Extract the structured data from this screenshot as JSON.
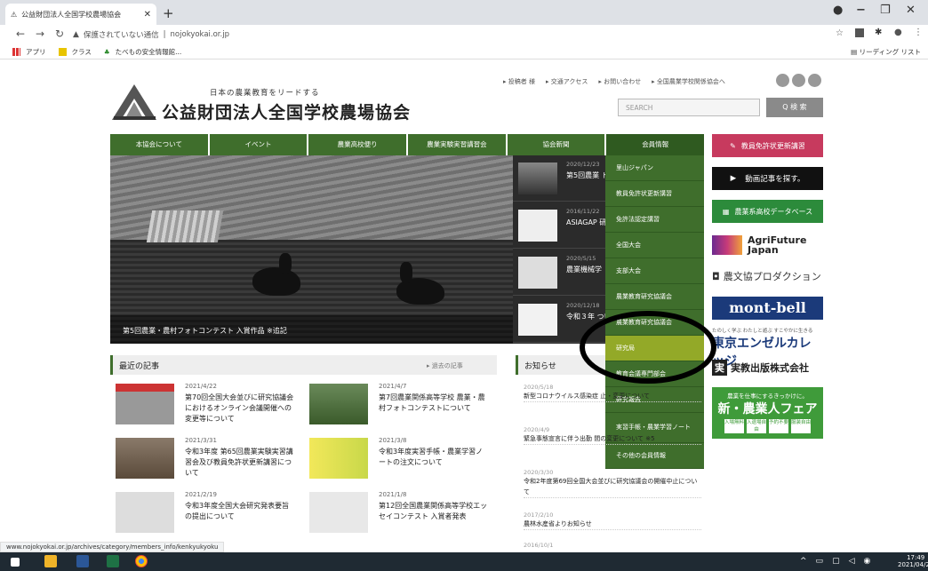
{
  "browser": {
    "tab_title": "公益財団法人全国学校農場協会",
    "address": "nojokyokai.or.jp",
    "security_label": "保護されていない通信",
    "bookmarks": [
      "アプリ",
      "クラス",
      "たべもの安全情報館..."
    ],
    "reading_list": "リーディング リスト"
  },
  "header": {
    "top_links": [
      "▸ 投稿者 様",
      "▸ 交通アクセス",
      "▸ お問い合わせ",
      "▸ 全国農業学校関係協会へ"
    ],
    "tagline": "日本の農業教育をリードする",
    "site_name": "公益財団法人全国学校農場協会",
    "search_placeholder": "SEARCH",
    "search_button": "Q 検 索"
  },
  "gnav": [
    "本協会について",
    "イベント",
    "農業高校便り",
    "農業実験実習講習会",
    "協会新聞",
    "会員情報"
  ],
  "hero": {
    "caption": "第5回農業・農村フォトコンテスト 入賞作品 ※追記",
    "thumbs": [
      {
        "date": "2020/12/23",
        "title": "第5回農業 ト 入賞作"
      },
      {
        "date": "2016/11/22",
        "title": "ASIAGAP 研修 て"
      },
      {
        "date": "2020/5/15",
        "title": "農業機械学 ト・QA"
      },
      {
        "date": "2020/12/18",
        "title": "令和３年 つい"
      }
    ]
  },
  "dropdown": [
    "里山ジャパン",
    "教員免許状更新講習",
    "免許法認定講習",
    "全国大会",
    "支部大会",
    "農業教育研究協議会",
    "農業教育研究協議会",
    "研究局",
    "教育会議専門部会",
    "研究報告",
    "実習手帳・農業学習ノート",
    "その他の会員情報"
  ],
  "sidebar": {
    "ad1": "教員免許状更新講習",
    "ad2": "動画記事を探す。",
    "ad3": "農業系高校データベース",
    "ad4": "AgriFuture Japan",
    "ad5": "農文協プロダクション",
    "ad6": "mont-bell",
    "ad7_sub": "たのしく学ぶ わたしと遊ぶ すこやかに生きる",
    "ad7": "東京エンゼルカレッジ",
    "ad8": "実教出版株式会社",
    "ad9_sub": "農業を仕事にするきっかけに。",
    "ad9": "新・農業人フェア",
    "ad9_btns": [
      "入場無料",
      "入退場自由",
      "予約不要",
      "服装自由"
    ]
  },
  "latest": {
    "title": "最近の記事",
    "more": "▸ 過去の記事",
    "items": [
      {
        "date": "2021/4/22",
        "title": "第70回全国大会並びに研究協議会におけるオンライン会議開催への変更等について"
      },
      {
        "date": "2021/4/7",
        "title": "第7回農業関係高等学校 農業・農村フォトコンテストについて"
      },
      {
        "date": "2021/3/31",
        "title": "令和3年度 第65回農業実験実習講習会及び教員免許状更新講習について"
      },
      {
        "date": "2021/3/8",
        "title": "令和3年度実習手帳・農業学習ノートの注文について"
      },
      {
        "date": "2021/2/19",
        "title": "令和3年度全国大会研究発表要旨の提出について"
      },
      {
        "date": "2021/1/8",
        "title": "第12回全国農業関係高等学校エッセイコンテスト 入賞者発表"
      }
    ]
  },
  "news": {
    "title": "お知らせ",
    "items": [
      {
        "date": "2020/5/18",
        "title": "新型コロナウイルス感染症 止・変更について"
      },
      {
        "date": "2020/4/9",
        "title": "緊急事態宣言に伴う出勤 間の変更について ※5"
      },
      {
        "date": "2020/3/30",
        "title": "令和2年度第69回全国大会並びに研究協議会の開催中止について"
      },
      {
        "date": "2017/2/10",
        "title": "農林水産省よりお知らせ"
      },
      {
        "date": "2016/10/1",
        "title": ""
      }
    ]
  },
  "status_url": "www.nojokyokai.or.jp/archives/category/members_info/kenkyukyoku",
  "clock": {
    "time": "17:49",
    "date": "2021/04/27"
  }
}
